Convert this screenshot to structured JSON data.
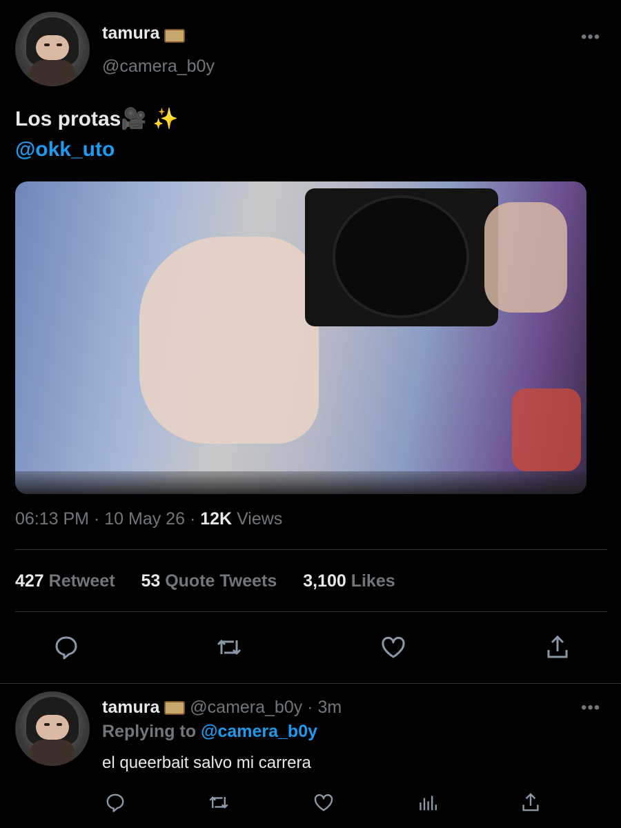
{
  "tweet": {
    "author_name": "tamura",
    "author_handle": "@camera_b0y",
    "text_line1": "Los protas",
    "text_emoji": "🎥 ✨",
    "mention": "@okk_uto",
    "time": "06:13 PM",
    "date": "10 May 26",
    "sep1": "·",
    "sep2": "·",
    "views_count": "12K",
    "views_label": "Views",
    "stats": {
      "retweets": "427",
      "retweets_label": "Retweet",
      "quotes": "53",
      "quotes_label": "Quote Tweets",
      "likes": "3,100",
      "likes_label": "Likes"
    },
    "more": "•••"
  },
  "reply": {
    "author_name": "tamura",
    "author_handle": "@camera_b0y",
    "sep": "·",
    "age": "3m",
    "replying_label": "Replying to",
    "replying_handle": "@camera_b0y",
    "text": "el queerbait salvo mi carrera",
    "more": "•••"
  },
  "icons": [
    "reply-icon",
    "retweet-icon",
    "like-icon",
    "share-icon",
    "views-icon"
  ],
  "colors": {
    "background": "#000000",
    "accent": "#1d9bf0",
    "muted": "#71767b",
    "text": "#e7e9ea"
  }
}
